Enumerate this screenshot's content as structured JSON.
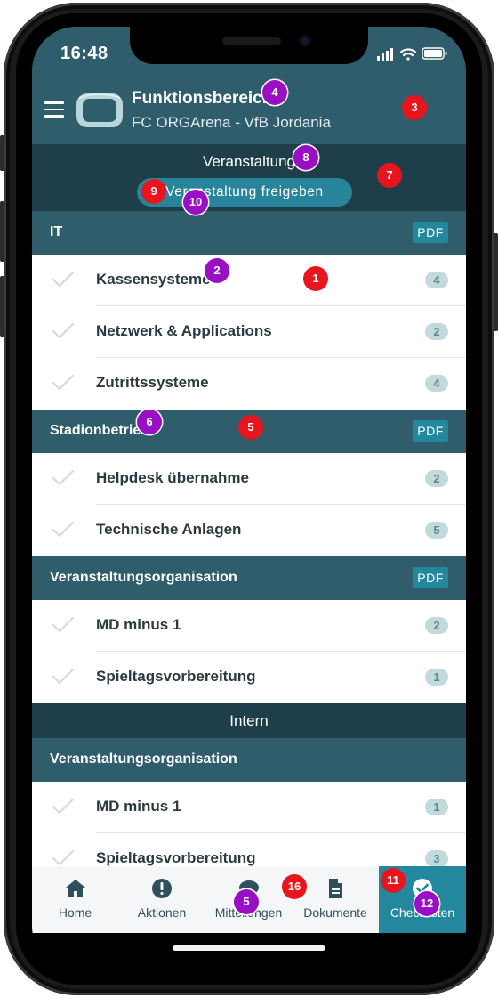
{
  "status_bar": {
    "time": "16:48"
  },
  "header": {
    "title": "Funktionsbereiche",
    "subtitle": "FC ORGArena - VfB Jordania"
  },
  "event_bar": {
    "title": "Veranstaltung",
    "button_label": "Veranstaltung freigeben"
  },
  "pdf_label": "PDF",
  "sections": [
    {
      "title": "IT",
      "pdf": true,
      "items": [
        {
          "label": "Kassensysteme",
          "count": "4"
        },
        {
          "label": "Netzwerk & Applications",
          "count": "2"
        },
        {
          "label": "Zutrittssysteme",
          "count": "4"
        }
      ]
    },
    {
      "title": "Stadionbetrieb",
      "pdf": true,
      "items": [
        {
          "label": "Helpdesk übernahme",
          "count": "2"
        },
        {
          "label": "Technische Anlagen",
          "count": "5"
        }
      ]
    },
    {
      "title": "Veranstaltungsorganisation",
      "pdf": true,
      "items": [
        {
          "label": "MD minus 1",
          "count": "2"
        },
        {
          "label": "Spieltagsvorbereitung",
          "count": "1"
        }
      ]
    }
  ],
  "intern": {
    "title": "Intern",
    "sections": [
      {
        "title": "Veranstaltungsorganisation",
        "pdf": false,
        "items": [
          {
            "label": "MD minus 1",
            "count": "1"
          },
          {
            "label": "Spieltagsvorbereitung",
            "count": "3"
          }
        ]
      }
    ]
  },
  "bottom_nav": [
    {
      "label": "Home",
      "icon": "home-icon",
      "active": false
    },
    {
      "label": "Aktionen",
      "icon": "alert-icon",
      "active": false
    },
    {
      "label": "Mitteilungen",
      "icon": "chat-icon",
      "active": false
    },
    {
      "label": "Dokumente",
      "icon": "document-icon",
      "active": false
    },
    {
      "label": "Checklisten",
      "icon": "checkmark-circle-icon",
      "active": true
    }
  ],
  "annotation_markers": [
    "1",
    "2",
    "3",
    "4",
    "5",
    "6",
    "7",
    "8",
    "9",
    "10",
    "5",
    "16",
    "11",
    "12"
  ],
  "colors": {
    "header": "#2f5d6b",
    "dark_band": "#1e3e4a",
    "accent": "#23879d",
    "badge": "#c3dadc",
    "marker_red": "#e8141e",
    "marker_purple": "#9b0fc4"
  }
}
